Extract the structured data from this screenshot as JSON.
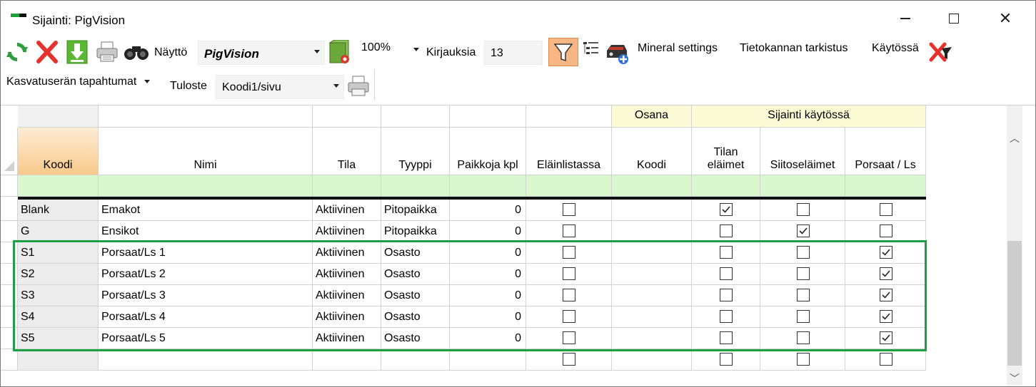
{
  "window": {
    "title": "Sijainti: PigVision"
  },
  "toolbar": {
    "naytto_label": "Näyttö",
    "naytto_value": "PigVision",
    "zoom_value": "100%",
    "kirjauksia_label": "Kirjauksia",
    "kirjauksia_value": "13",
    "mineral_settings": "Mineral settings",
    "tietokanta": "Tietokannan tarkistus",
    "kaytossa": "Käytössä",
    "kasvatuseran": "Kasvatuserän tapahtumat",
    "tuloste_label": "Tuloste",
    "tuloste_value": "Koodi1/sivu",
    "colors": {
      "refresh": "#2e9d3e",
      "delete": "#e5322d",
      "download": "#5ab833",
      "filter_active": "#f7b784"
    }
  },
  "grid": {
    "group_headers": {
      "osana": "Osana",
      "sijainti": "Sijainti käytössä"
    },
    "columns": {
      "koodi": "Koodi",
      "nimi": "Nimi",
      "tila": "Tila",
      "tyyppi": "Tyyppi",
      "paikkoja": "Paikkoja kpl",
      "elainlistassa": "Eläinlistassa",
      "osana_koodi": "Koodi",
      "tilan_line1": "Tilan",
      "tilan_line2": "eläimet",
      "siitos": "Siitoseläimet",
      "porsaat": "Porsaat / Ls"
    },
    "rows": [
      {
        "koodi": "Blank",
        "nimi": "Emakot",
        "tila": "Aktiivinen",
        "tyyppi": "Pitopaikka",
        "paikkoja": "0",
        "elain": false,
        "tilan": true,
        "siitos": false,
        "porsaat": false
      },
      {
        "koodi": "G",
        "nimi": "Ensikot",
        "tila": "Aktiivinen",
        "tyyppi": "Pitopaikka",
        "paikkoja": "0",
        "elain": false,
        "tilan": false,
        "siitos": true,
        "porsaat": false
      },
      {
        "koodi": "S1",
        "nimi": "Porsaat/Ls 1",
        "tila": "Aktiivinen",
        "tyyppi": "Osasto",
        "paikkoja": "0",
        "elain": false,
        "tilan": false,
        "siitos": false,
        "porsaat": true
      },
      {
        "koodi": "S2",
        "nimi": "Porsaat/Ls 2",
        "tila": "Aktiivinen",
        "tyyppi": "Osasto",
        "paikkoja": "0",
        "elain": false,
        "tilan": false,
        "siitos": false,
        "porsaat": true
      },
      {
        "koodi": "S3",
        "nimi": "Porsaat/Ls 3",
        "tila": "Aktiivinen",
        "tyyppi": "Osasto",
        "paikkoja": "0",
        "elain": false,
        "tilan": false,
        "siitos": false,
        "porsaat": true
      },
      {
        "koodi": "S4",
        "nimi": "Porsaat/Ls 4",
        "tila": "Aktiivinen",
        "tyyppi": "Osasto",
        "paikkoja": "0",
        "elain": false,
        "tilan": false,
        "siitos": false,
        "porsaat": true
      },
      {
        "koodi": "S5",
        "nimi": "Porsaat/Ls 5",
        "tila": "Aktiivinen",
        "tyyppi": "Osasto",
        "paikkoja": "0",
        "elain": false,
        "tilan": false,
        "siitos": false,
        "porsaat": true
      }
    ],
    "colors": {
      "highlight": "#1e9e45",
      "koodi_header": "#f8c98a",
      "filter_row": "#d9f7cf",
      "group_header": "#fdfbd6"
    }
  }
}
